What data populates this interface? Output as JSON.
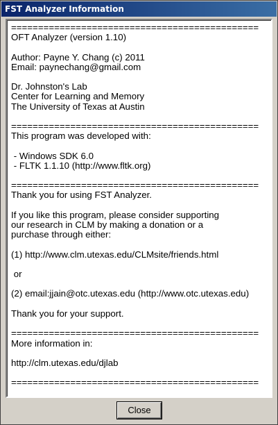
{
  "window": {
    "title": "FST Analyzer Information"
  },
  "content": {
    "text": "==============================================\nOFT Analyzer (version 1.10)\n\nAuthor: Payne Y. Chang (c) 2011\nEmail: paynechang@gmail.com\n\nDr. Johnston's Lab\nCenter for Learning and Memory\nThe University of Texas at Austin\n\n==============================================\nThis program was developed with:\n\n - Windows SDK 6.0\n - FLTK 1.1.10 (http://www.fltk.org)\n\n==============================================\nThank you for using FST Analyzer.\n\nIf you like this program, please consider supporting\nour research in CLM by making a donation or a\npurchase through either:\n\n(1) http://www.clm.utexas.edu/CLMsite/friends.html\n\n or\n\n(2) email:jjain@otc.utexas.edu (http://www.otc.utexas.edu)\n\nThank you for your support.\n\n==============================================\nMore information in:\n\nhttp://clm.utexas.edu/djlab\n\n=============================================="
  },
  "buttons": {
    "close_label": "Close"
  }
}
